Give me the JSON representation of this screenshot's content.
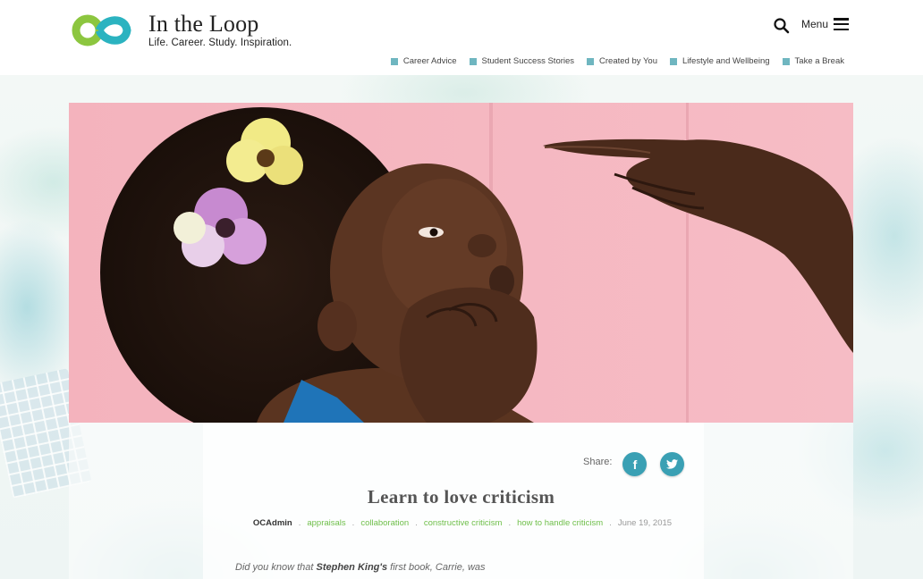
{
  "brand": {
    "title": "In the Loop",
    "tagline": "Life. Career. Study. Inspiration.",
    "colors": {
      "logo_green": "#8cc63f",
      "logo_teal": "#2bb3c0",
      "accent": "#3aa0b4",
      "tag_green": "#6fbf4a",
      "nav_bullet": "#6fb6c0"
    }
  },
  "header": {
    "search_icon": "search-icon",
    "menu_label": "Menu",
    "nav": [
      {
        "label": "Career Advice"
      },
      {
        "label": "Student Success Stories"
      },
      {
        "label": "Created by You"
      },
      {
        "label": "Lifestyle and Wellbeing"
      },
      {
        "label": "Take a Break"
      }
    ]
  },
  "article": {
    "share_label": "Share:",
    "share": [
      {
        "icon": "facebook-icon",
        "glyph": "f"
      },
      {
        "icon": "twitter-icon",
        "glyph": "t"
      }
    ],
    "title": "Learn to love criticism",
    "author": "OCAdmin",
    "tags": [
      "appraisals",
      "collaboration",
      "constructive criticism",
      "how to handle criticism"
    ],
    "date": "June 19, 2015",
    "excerpt_start": "Did you know that ",
    "excerpt_bold": "Stephen King's",
    "excerpt_end": " first book, Carrie, was"
  }
}
